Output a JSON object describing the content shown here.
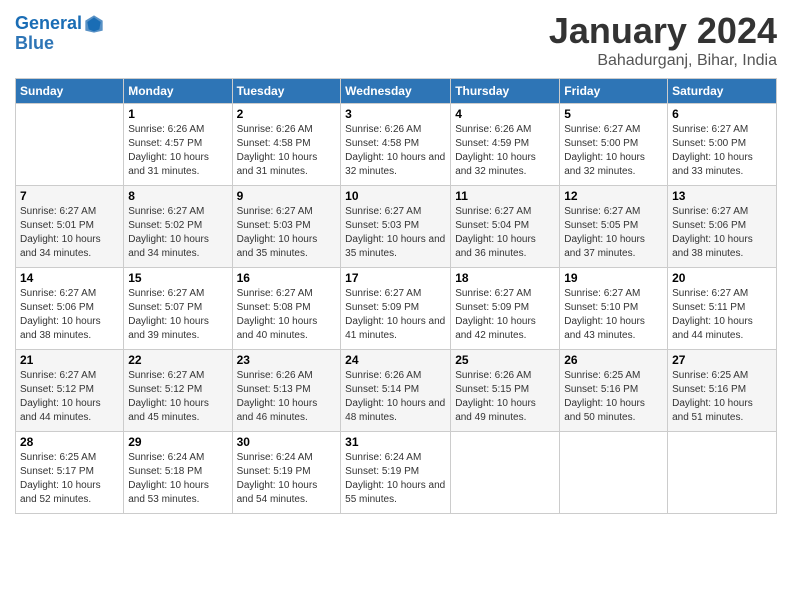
{
  "header": {
    "logo_line1": "General",
    "logo_line2": "Blue",
    "month_title": "January 2024",
    "location": "Bahadurganj, Bihar, India"
  },
  "days_of_week": [
    "Sunday",
    "Monday",
    "Tuesday",
    "Wednesday",
    "Thursday",
    "Friday",
    "Saturday"
  ],
  "weeks": [
    [
      {
        "day": "",
        "sunrise": "",
        "sunset": "",
        "daylight": ""
      },
      {
        "day": "1",
        "sunrise": "Sunrise: 6:26 AM",
        "sunset": "Sunset: 4:57 PM",
        "daylight": "Daylight: 10 hours and 31 minutes."
      },
      {
        "day": "2",
        "sunrise": "Sunrise: 6:26 AM",
        "sunset": "Sunset: 4:58 PM",
        "daylight": "Daylight: 10 hours and 31 minutes."
      },
      {
        "day": "3",
        "sunrise": "Sunrise: 6:26 AM",
        "sunset": "Sunset: 4:58 PM",
        "daylight": "Daylight: 10 hours and 32 minutes."
      },
      {
        "day": "4",
        "sunrise": "Sunrise: 6:26 AM",
        "sunset": "Sunset: 4:59 PM",
        "daylight": "Daylight: 10 hours and 32 minutes."
      },
      {
        "day": "5",
        "sunrise": "Sunrise: 6:27 AM",
        "sunset": "Sunset: 5:00 PM",
        "daylight": "Daylight: 10 hours and 32 minutes."
      },
      {
        "day": "6",
        "sunrise": "Sunrise: 6:27 AM",
        "sunset": "Sunset: 5:00 PM",
        "daylight": "Daylight: 10 hours and 33 minutes."
      }
    ],
    [
      {
        "day": "7",
        "sunrise": "Sunrise: 6:27 AM",
        "sunset": "Sunset: 5:01 PM",
        "daylight": "Daylight: 10 hours and 34 minutes."
      },
      {
        "day": "8",
        "sunrise": "Sunrise: 6:27 AM",
        "sunset": "Sunset: 5:02 PM",
        "daylight": "Daylight: 10 hours and 34 minutes."
      },
      {
        "day": "9",
        "sunrise": "Sunrise: 6:27 AM",
        "sunset": "Sunset: 5:03 PM",
        "daylight": "Daylight: 10 hours and 35 minutes."
      },
      {
        "day": "10",
        "sunrise": "Sunrise: 6:27 AM",
        "sunset": "Sunset: 5:03 PM",
        "daylight": "Daylight: 10 hours and 35 minutes."
      },
      {
        "day": "11",
        "sunrise": "Sunrise: 6:27 AM",
        "sunset": "Sunset: 5:04 PM",
        "daylight": "Daylight: 10 hours and 36 minutes."
      },
      {
        "day": "12",
        "sunrise": "Sunrise: 6:27 AM",
        "sunset": "Sunset: 5:05 PM",
        "daylight": "Daylight: 10 hours and 37 minutes."
      },
      {
        "day": "13",
        "sunrise": "Sunrise: 6:27 AM",
        "sunset": "Sunset: 5:06 PM",
        "daylight": "Daylight: 10 hours and 38 minutes."
      }
    ],
    [
      {
        "day": "14",
        "sunrise": "Sunrise: 6:27 AM",
        "sunset": "Sunset: 5:06 PM",
        "daylight": "Daylight: 10 hours and 38 minutes."
      },
      {
        "day": "15",
        "sunrise": "Sunrise: 6:27 AM",
        "sunset": "Sunset: 5:07 PM",
        "daylight": "Daylight: 10 hours and 39 minutes."
      },
      {
        "day": "16",
        "sunrise": "Sunrise: 6:27 AM",
        "sunset": "Sunset: 5:08 PM",
        "daylight": "Daylight: 10 hours and 40 minutes."
      },
      {
        "day": "17",
        "sunrise": "Sunrise: 6:27 AM",
        "sunset": "Sunset: 5:09 PM",
        "daylight": "Daylight: 10 hours and 41 minutes."
      },
      {
        "day": "18",
        "sunrise": "Sunrise: 6:27 AM",
        "sunset": "Sunset: 5:09 PM",
        "daylight": "Daylight: 10 hours and 42 minutes."
      },
      {
        "day": "19",
        "sunrise": "Sunrise: 6:27 AM",
        "sunset": "Sunset: 5:10 PM",
        "daylight": "Daylight: 10 hours and 43 minutes."
      },
      {
        "day": "20",
        "sunrise": "Sunrise: 6:27 AM",
        "sunset": "Sunset: 5:11 PM",
        "daylight": "Daylight: 10 hours and 44 minutes."
      }
    ],
    [
      {
        "day": "21",
        "sunrise": "Sunrise: 6:27 AM",
        "sunset": "Sunset: 5:12 PM",
        "daylight": "Daylight: 10 hours and 44 minutes."
      },
      {
        "day": "22",
        "sunrise": "Sunrise: 6:27 AM",
        "sunset": "Sunset: 5:12 PM",
        "daylight": "Daylight: 10 hours and 45 minutes."
      },
      {
        "day": "23",
        "sunrise": "Sunrise: 6:26 AM",
        "sunset": "Sunset: 5:13 PM",
        "daylight": "Daylight: 10 hours and 46 minutes."
      },
      {
        "day": "24",
        "sunrise": "Sunrise: 6:26 AM",
        "sunset": "Sunset: 5:14 PM",
        "daylight": "Daylight: 10 hours and 48 minutes."
      },
      {
        "day": "25",
        "sunrise": "Sunrise: 6:26 AM",
        "sunset": "Sunset: 5:15 PM",
        "daylight": "Daylight: 10 hours and 49 minutes."
      },
      {
        "day": "26",
        "sunrise": "Sunrise: 6:25 AM",
        "sunset": "Sunset: 5:16 PM",
        "daylight": "Daylight: 10 hours and 50 minutes."
      },
      {
        "day": "27",
        "sunrise": "Sunrise: 6:25 AM",
        "sunset": "Sunset: 5:16 PM",
        "daylight": "Daylight: 10 hours and 51 minutes."
      }
    ],
    [
      {
        "day": "28",
        "sunrise": "Sunrise: 6:25 AM",
        "sunset": "Sunset: 5:17 PM",
        "daylight": "Daylight: 10 hours and 52 minutes."
      },
      {
        "day": "29",
        "sunrise": "Sunrise: 6:24 AM",
        "sunset": "Sunset: 5:18 PM",
        "daylight": "Daylight: 10 hours and 53 minutes."
      },
      {
        "day": "30",
        "sunrise": "Sunrise: 6:24 AM",
        "sunset": "Sunset: 5:19 PM",
        "daylight": "Daylight: 10 hours and 54 minutes."
      },
      {
        "day": "31",
        "sunrise": "Sunrise: 6:24 AM",
        "sunset": "Sunset: 5:19 PM",
        "daylight": "Daylight: 10 hours and 55 minutes."
      },
      {
        "day": "",
        "sunrise": "",
        "sunset": "",
        "daylight": ""
      },
      {
        "day": "",
        "sunrise": "",
        "sunset": "",
        "daylight": ""
      },
      {
        "day": "",
        "sunrise": "",
        "sunset": "",
        "daylight": ""
      }
    ]
  ]
}
